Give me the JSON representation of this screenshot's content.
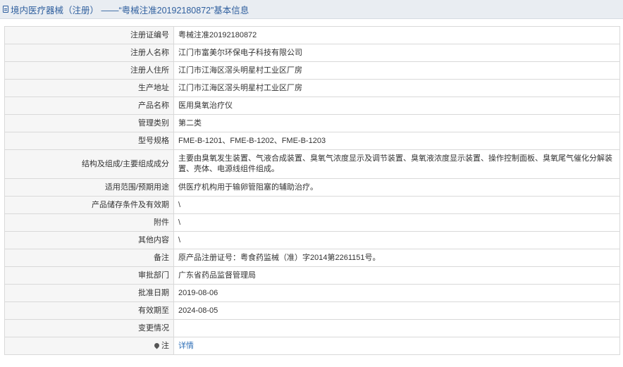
{
  "header": {
    "icon": "document-icon",
    "title": "境内医疗器械（注册） ——“粤械注准20192180872”基本信息"
  },
  "rows": [
    {
      "label": "注册证编号",
      "value": "粤械注准20192180872"
    },
    {
      "label": "注册人名称",
      "value": "江门市富美尔环保电子科技有限公司"
    },
    {
      "label": "注册人住所",
      "value": "江门市江海区滘头明星村工业区厂房"
    },
    {
      "label": "生产地址",
      "value": "江门市江海区滘头明星村工业区厂房"
    },
    {
      "label": "产品名称",
      "value": "医用臭氧治疗仪"
    },
    {
      "label": "管理类别",
      "value": "第二类"
    },
    {
      "label": "型号规格",
      "value": "FME-B-1201、FME-B-1202、FME-B-1203"
    },
    {
      "label": "结构及组成/主要组成成分",
      "value": "主要由臭氧发生装置、气液合成装置、臭氧气浓度显示及调节装置、臭氧液浓度显示装置、操作控制面板、臭氧尾气催化分解装置、壳体、电源线组件组成。"
    },
    {
      "label": "适用范围/预期用途",
      "value": "供医疗机构用于输卵管阻塞的辅助治疗。"
    },
    {
      "label": "产品储存条件及有效期",
      "value": "\\"
    },
    {
      "label": "附件",
      "value": "\\"
    },
    {
      "label": "其他内容",
      "value": "\\"
    },
    {
      "label": "备注",
      "value": "原产品注册证号：粤食药监械（准）字2014第2261151号。"
    },
    {
      "label": "审批部门",
      "value": "广东省药品监督管理局"
    },
    {
      "label": "批准日期",
      "value": "2019-08-06"
    },
    {
      "label": "有效期至",
      "value": "2024-08-05"
    },
    {
      "label": "变更情况",
      "value": ""
    },
    {
      "label": "注",
      "value": "详情",
      "icon": "pin-icon"
    }
  ],
  "colors": {
    "link": "#2f6fb7",
    "header_text": "#2f5f9e"
  }
}
